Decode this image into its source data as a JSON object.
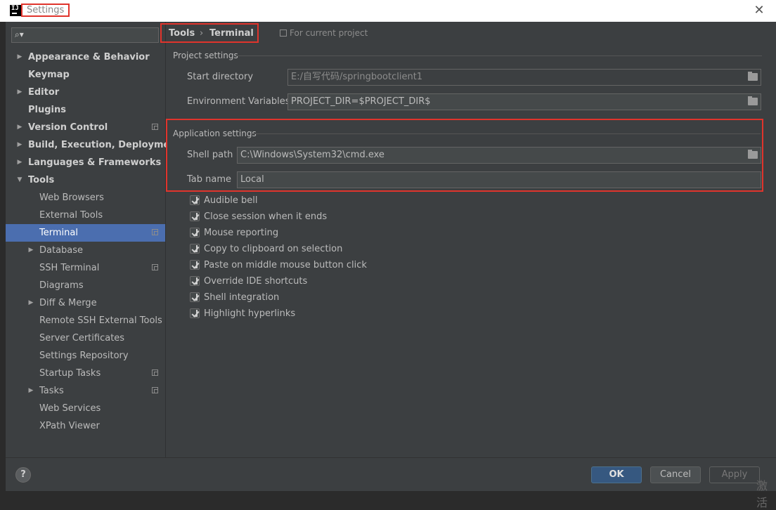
{
  "window": {
    "title": "Settings",
    "app_icon_letters": "IJ"
  },
  "sidebar": {
    "search_placeholder": "",
    "items": [
      {
        "label": "Appearance & Behavior",
        "expandable": true,
        "expanded": false,
        "level": 0,
        "bold": true
      },
      {
        "label": "Keymap",
        "expandable": false,
        "level": 0,
        "bold": true
      },
      {
        "label": "Editor",
        "expandable": true,
        "expanded": false,
        "level": 0,
        "bold": true
      },
      {
        "label": "Plugins",
        "expandable": false,
        "level": 0,
        "bold": true
      },
      {
        "label": "Version Control",
        "expandable": true,
        "expanded": false,
        "level": 0,
        "bold": true,
        "project": true
      },
      {
        "label": "Build, Execution, Deployment",
        "expandable": true,
        "expanded": false,
        "level": 0,
        "bold": true
      },
      {
        "label": "Languages & Frameworks",
        "expandable": true,
        "expanded": false,
        "level": 0,
        "bold": true
      },
      {
        "label": "Tools",
        "expandable": true,
        "expanded": true,
        "level": 0,
        "bold": true
      },
      {
        "label": "Web Browsers",
        "expandable": false,
        "level": 1
      },
      {
        "label": "External Tools",
        "expandable": false,
        "level": 1
      },
      {
        "label": "Terminal",
        "expandable": false,
        "level": 1,
        "selected": true,
        "project": true
      },
      {
        "label": "Database",
        "expandable": true,
        "expanded": false,
        "level": 1
      },
      {
        "label": "SSH Terminal",
        "expandable": false,
        "level": 1,
        "project": true
      },
      {
        "label": "Diagrams",
        "expandable": false,
        "level": 1
      },
      {
        "label": "Diff & Merge",
        "expandable": true,
        "expanded": false,
        "level": 1
      },
      {
        "label": "Remote SSH External Tools",
        "expandable": false,
        "level": 1
      },
      {
        "label": "Server Certificates",
        "expandable": false,
        "level": 1
      },
      {
        "label": "Settings Repository",
        "expandable": false,
        "level": 1
      },
      {
        "label": "Startup Tasks",
        "expandable": false,
        "level": 1,
        "project": true
      },
      {
        "label": "Tasks",
        "expandable": true,
        "expanded": false,
        "level": 1,
        "project": true
      },
      {
        "label": "Web Services",
        "expandable": false,
        "level": 1
      },
      {
        "label": "XPath Viewer",
        "expandable": false,
        "level": 1
      }
    ]
  },
  "breadcrumb": {
    "parent": "Tools",
    "separator": "›",
    "current": "Terminal",
    "scope": "For current project"
  },
  "project_settings": {
    "title": "Project settings",
    "start_directory_label": "Start directory",
    "start_directory_value": "E:/自写代码/springbootclient1",
    "env_vars_label": "Environment Variables",
    "env_vars_value": "PROJECT_DIR=$PROJECT_DIR$"
  },
  "app_settings": {
    "title": "Application settings",
    "shell_path_label": "Shell path",
    "shell_path_value": "C:\\Windows\\System32\\cmd.exe",
    "tab_name_label": "Tab name",
    "tab_name_value": "Local"
  },
  "options": [
    {
      "label": "Audible bell",
      "checked": true
    },
    {
      "label": "Close session when it ends",
      "checked": true
    },
    {
      "label": "Mouse reporting",
      "checked": true
    },
    {
      "label": "Copy to clipboard on selection",
      "checked": true
    },
    {
      "label": "Paste on middle mouse button click",
      "checked": true
    },
    {
      "label": "Override IDE shortcuts",
      "checked": true
    },
    {
      "label": "Shell integration",
      "checked": true
    },
    {
      "label": "Highlight hyperlinks",
      "checked": true
    }
  ],
  "footer": {
    "help": "?",
    "ok": "OK",
    "cancel": "Cancel",
    "apply": "Apply"
  },
  "watermark": "激活"
}
